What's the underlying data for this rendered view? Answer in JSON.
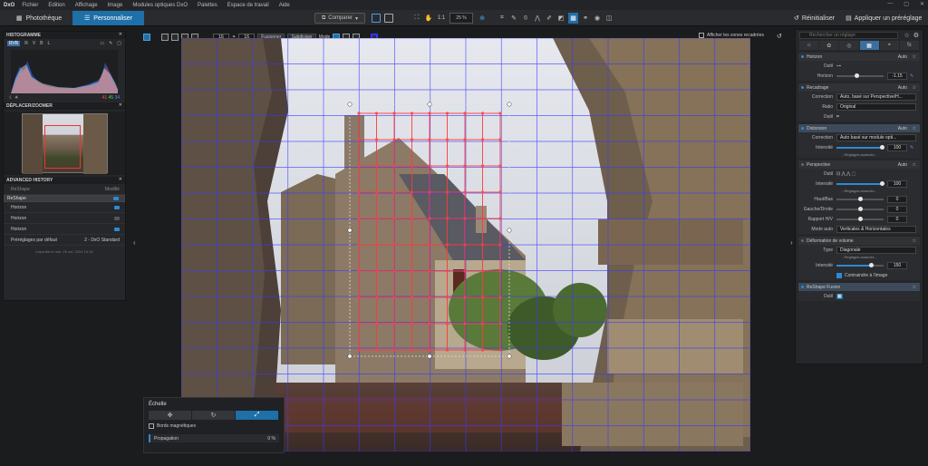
{
  "app": {
    "logo": "DxO"
  },
  "menu": [
    "Fichier",
    "Edition",
    "Affichage",
    "Image",
    "Modules optiques DxO",
    "Palettes",
    "Espace de travail",
    "Aide"
  ],
  "tabs": {
    "phototheque": "Photothèque",
    "personnaliser": "Personnaliser"
  },
  "toolbar": {
    "compare": "Comparer",
    "ratio": "1:1",
    "zoom": "25 %"
  },
  "right_header": {
    "reset": "Réinitialiser",
    "apply_preset": "Appliquer un préréglage"
  },
  "histogram": {
    "title": "HISTOGRAMME",
    "channels": [
      "RVB",
      "R",
      "V",
      "B",
      "L"
    ],
    "values": {
      "r": "41",
      "g": "45",
      "b": "34"
    }
  },
  "navigator": {
    "title": "DÉPLACER/ZOOMER"
  },
  "history": {
    "title": "ADVANCED HISTORY",
    "col_left": "ReShape",
    "col_right": "Modifié",
    "rows": [
      {
        "label": "ReShape",
        "state": "on"
      },
      {
        "label": "Horizon",
        "state": "on"
      },
      {
        "label": "Horizon",
        "state": "off"
      },
      {
        "label": "Horizon",
        "state": "on"
      }
    ],
    "preset_label": "Préréglages par défaut",
    "preset_value": "2 - DxO Standard",
    "imported": "Importée le mer. 25 oct. 2024 15:16"
  },
  "canvas_toolbar": {
    "grid_x": "16",
    "grid_y": "16",
    "merge": "Fusionner",
    "subdivide": "Subdiviser",
    "mode": "Mode"
  },
  "show_zones": "Afficher les zones recadrées",
  "scale_popup": {
    "title": "Échelle",
    "magnetic": "Bords magnétiques",
    "propagation": "Propagation",
    "propagation_value": "0 %"
  },
  "panel": {
    "search_placeholder": "Rechercher un réglage",
    "horizon": {
      "title": "Horizon",
      "auto": "Auto",
      "tool": "Outil",
      "slider_label": "Horizon",
      "value": "-1.15"
    },
    "recadrage": {
      "title": "Recadrage",
      "auto": "Auto",
      "correction_label": "Correction",
      "correction": "Auto, basé sur Perspective/H...",
      "ratio_label": "Ratio",
      "ratio": "Original",
      "tool": "Outil"
    },
    "distorsion": {
      "title": "Distorsion",
      "auto": "Auto",
      "correction_label": "Correction",
      "correction": "Auto basé sur module opti...",
      "intensity_label": "Intensité",
      "intensity": "100",
      "adv": "- Réglages avancés -"
    },
    "perspective": {
      "title": "Perspective",
      "auto": "Auto",
      "tool": "Outil",
      "intensity_label": "Intensité",
      "intensity": "100",
      "adv": "- Réglages avancés -",
      "hb_label": "Haut/Bas",
      "hb": "0",
      "gd_label": "Gauche/Droite",
      "gd": "0",
      "rh_label": "Rapport H/V",
      "rh": "0",
      "mode_label": "Mode auto",
      "mode": "Verticales & Horizontales"
    },
    "volume": {
      "title": "Déformation de volume",
      "type_label": "Type",
      "type": "Diagonale",
      "adv": "- Réglages avancés -",
      "intensity_label": "Intensité",
      "intensity": "150",
      "constrain": "Contraindre à l'image"
    },
    "reshape": {
      "title": "ReShape Fusion",
      "tool": "Outil"
    }
  },
  "colors": {
    "accent": "#1f6fa8",
    "grid_blue": "#3b3bff",
    "grid_red": "#ff3030"
  }
}
